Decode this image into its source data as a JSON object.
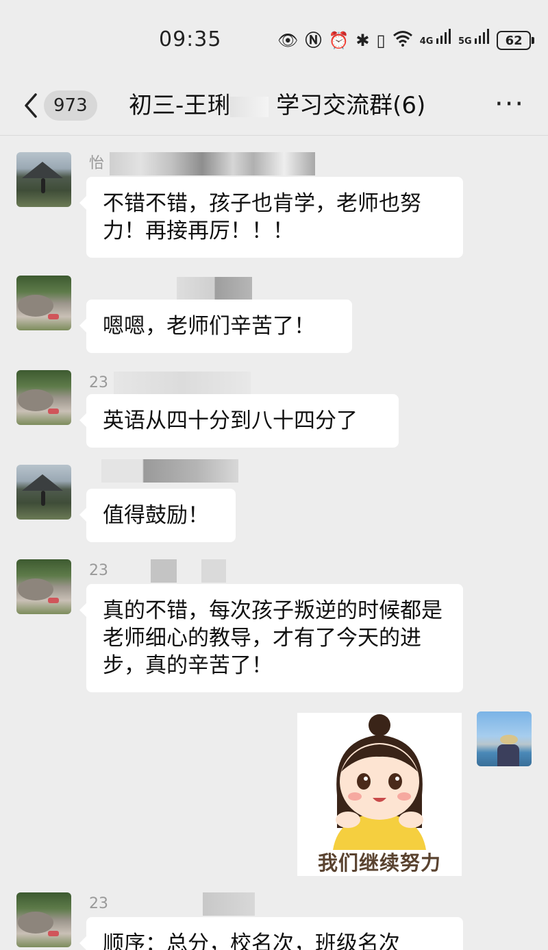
{
  "status_bar": {
    "time": "09:35",
    "icons": [
      "eye-icon",
      "nfc-icon",
      "alarm-icon",
      "bluetooth-icon",
      "vibrate-icon",
      "wifi-icon",
      "signal-4g-icon",
      "signal-5g-icon"
    ],
    "net_4g": "4G",
    "net_5g": "5G",
    "battery": "62"
  },
  "nav": {
    "unread_count": "973",
    "title_prefix": "初三-王琍",
    "title_suffix": "学习交流群(6)",
    "more": "···"
  },
  "messages": [
    {
      "sender": "怡",
      "avatar": "mountain",
      "text": "不错不错，孩子也肯学，老师也努力！再接再厉！！！"
    },
    {
      "sender": "",
      "avatar": "rock",
      "text": "嗯嗯，老师们辛苦了！"
    },
    {
      "sender": "23",
      "avatar": "rock",
      "text": "英语从四十分到八十四分了"
    },
    {
      "sender": "",
      "avatar": "mountain",
      "text": "值得鼓励！"
    },
    {
      "sender": "23",
      "avatar": "rock",
      "text": "真的不错，每次孩子叛逆的时候都是老师细心的教导，才有了今天的进步，真的辛苦了！"
    },
    {
      "sender": "23",
      "avatar": "rock",
      "text": "顺序：总分，校名次，班级名次"
    }
  ],
  "self_message": {
    "avatar": "lake",
    "sticker_caption": "我们继续努力"
  },
  "colors": {
    "background": "#ededed",
    "bubble": "#ffffff",
    "sender": "#999999"
  }
}
